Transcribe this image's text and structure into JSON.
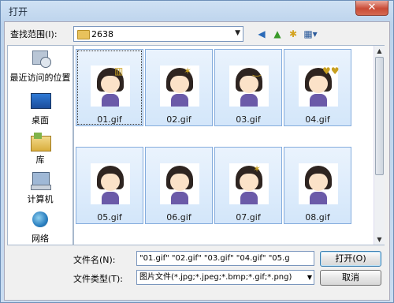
{
  "window": {
    "title": "打开",
    "close_glyph": "✕"
  },
  "toolbar": {
    "lookin_label": "查找范围(I):",
    "lookin_value": "2638",
    "back_glyph": "◀",
    "up_glyph": "▲",
    "newfolder_glyph": "✱",
    "views_glyph": "▦▾"
  },
  "places": [
    {
      "label": "最近访问的位置",
      "icon": "recent-places-icon"
    },
    {
      "label": "桌面",
      "icon": "desktop-icon"
    },
    {
      "label": "库",
      "icon": "libraries-icon"
    },
    {
      "label": "计算机",
      "icon": "computer-icon"
    },
    {
      "label": "网络",
      "icon": "network-icon"
    }
  ],
  "files": [
    {
      "name": "01.gif",
      "deco": "▥"
    },
    {
      "name": "02.gif",
      "deco": "✶"
    },
    {
      "name": "03.gif",
      "deco": "‿"
    },
    {
      "name": "04.gif",
      "deco": "♥♥"
    },
    {
      "name": "05.gif",
      "deco": ""
    },
    {
      "name": "06.gif",
      "deco": ""
    },
    {
      "name": "07.gif",
      "deco": "✶"
    },
    {
      "name": "08.gif",
      "deco": ""
    }
  ],
  "filename": {
    "label": "文件名(N):",
    "value": "\"01.gif\" \"02.gif\" \"03.gif\" \"04.gif\" \"05.g"
  },
  "filetype": {
    "label": "文件类型(T):",
    "value": "图片文件(*.jpg;*.jpeg;*.bmp;*.gif;*.png)"
  },
  "buttons": {
    "open": "打开(O)",
    "cancel": "取消"
  },
  "colors": {
    "selection": "#d3e6fa",
    "selection_border": "#84acdd",
    "title_bar": "#c9dcf1"
  }
}
